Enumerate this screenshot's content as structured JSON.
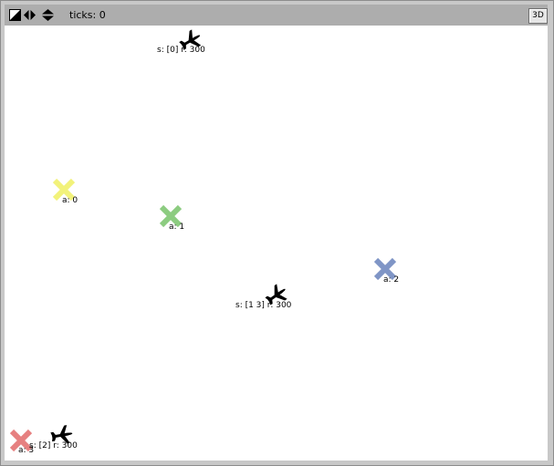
{
  "toolbar": {
    "ticks_text": "ticks: 0",
    "view3d_label": "3D",
    "icons": [
      "settings-icon",
      "step-arrows-icon",
      "speed-arrows-icon"
    ]
  },
  "colors": {
    "chrome": "#adadad",
    "canvas": "#ffffff",
    "agent_0": "#f2f27a",
    "agent_1": "#8ccc80",
    "agent_2": "#7f95c6",
    "agent_3": "#e68080",
    "plane": "#000000"
  },
  "planes": [
    {
      "label": "s: [0] r: 300"
    },
    {
      "label": "s: [1 3] r: 300"
    },
    {
      "label": "s: [2] r: 300"
    }
  ],
  "targets": [
    {
      "label": "a: 0",
      "color": "#f2f27a"
    },
    {
      "label": "a: 1",
      "color": "#8ccc80"
    },
    {
      "label": "a: 2",
      "color": "#7f95c6"
    },
    {
      "label": "a: 3",
      "color": "#e68080"
    }
  ]
}
